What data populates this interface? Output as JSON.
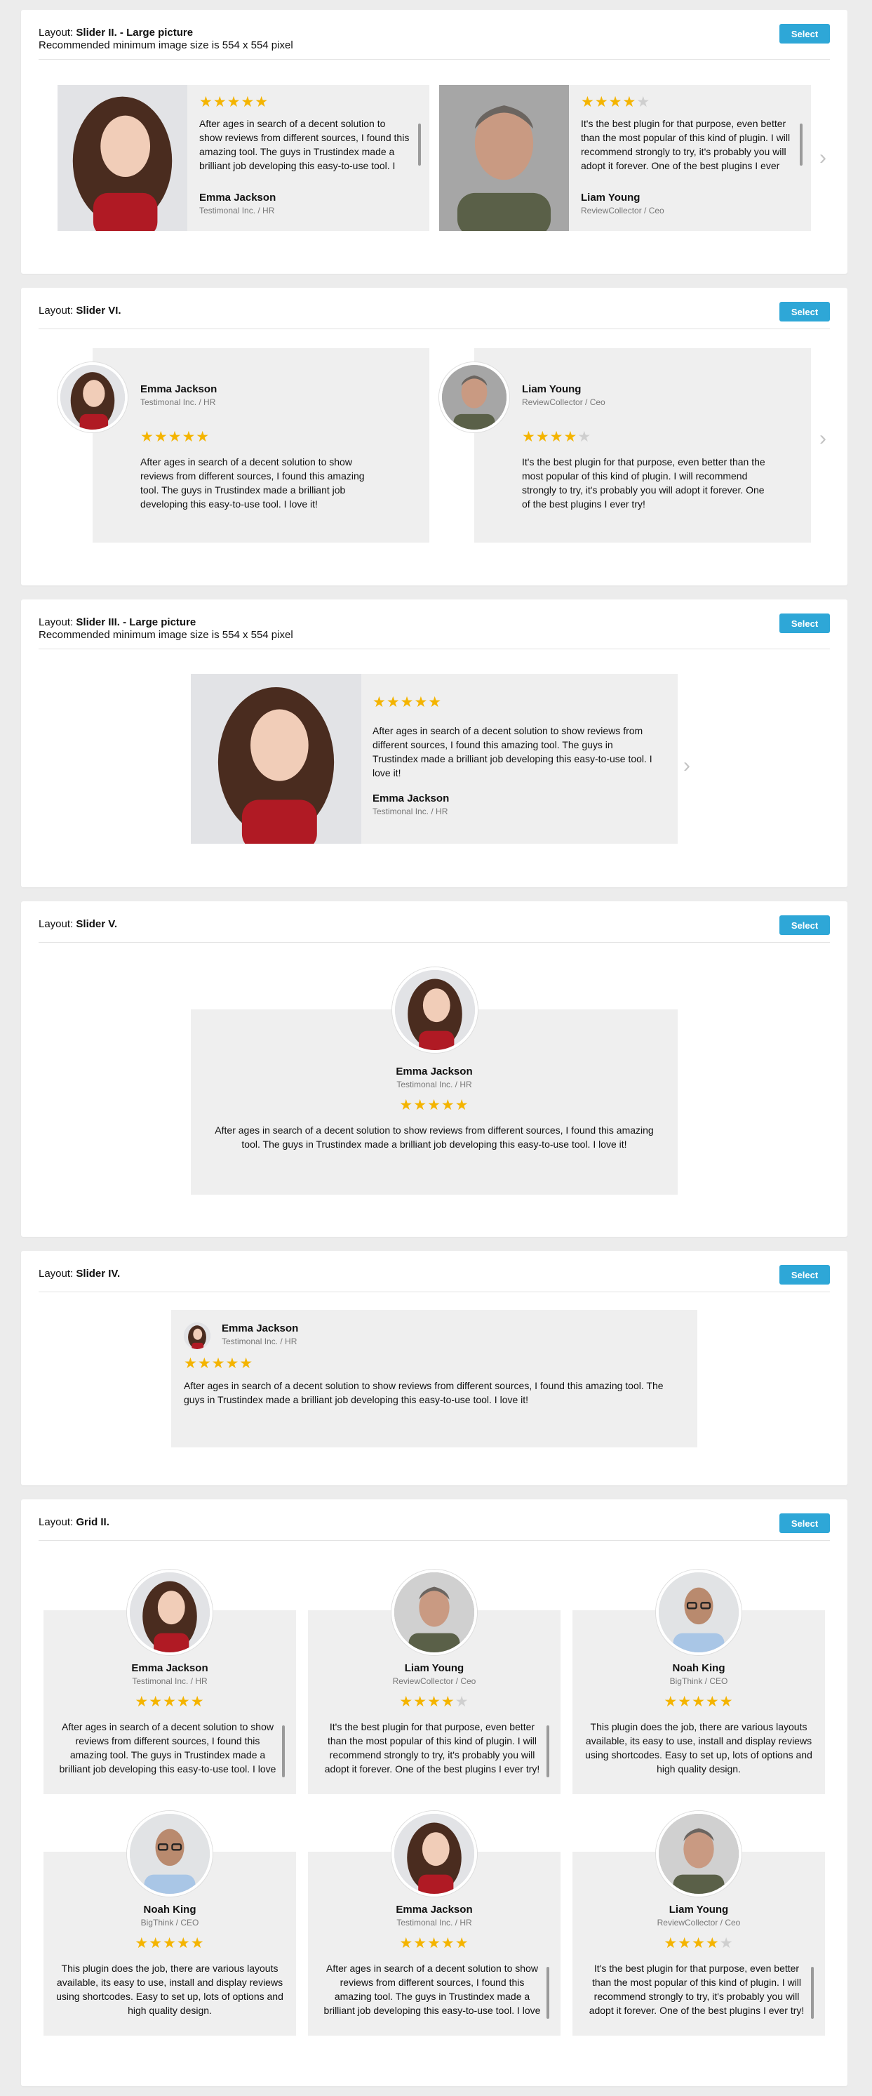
{
  "common": {
    "select_label": "Select",
    "layout_prefix": "Layout:",
    "min_size_note": "Recommended minimum image size is 554 x 554 pixel"
  },
  "reviews": {
    "emma": {
      "name": "Emma Jackson",
      "company": "Testimonal Inc. / HR",
      "stars": 5,
      "text": "After ages in search of a decent solution to show reviews from different sources, I found this amazing tool. The guys in Trustindex made a brilliant job developing this easy-to-use tool. I love it!"
    },
    "liam": {
      "name": "Liam Young",
      "company": "ReviewCollector / Ceo",
      "stars": 4,
      "text": "It's the best plugin for that purpose, even better than the most popular of this kind of plugin. I will recommend strongly to try, it's probably you will adopt it forever. One of the best plugins I ever try!"
    },
    "noah": {
      "name": "Noah King",
      "company": "BigThink / CEO",
      "stars": 5,
      "text": "This plugin does the job, there are various layouts available, its easy to use, install and display reviews using shortcodes. Easy to set up, lots of options and high quality design."
    }
  },
  "panels": {
    "slider2": {
      "name": "Slider II. - Large picture"
    },
    "slider6": {
      "name": "Slider VI."
    },
    "slider3": {
      "name": "Slider III. - Large picture"
    },
    "slider5": {
      "name": "Slider V."
    },
    "slider4": {
      "name": "Slider IV."
    },
    "grid2": {
      "name": "Grid II."
    }
  },
  "icons": {
    "star": "star-icon",
    "star_empty": "star-empty-icon",
    "chevron_right": "chevron-right-icon"
  },
  "colors": {
    "accent": "#2ea7d7",
    "star": "#f4b400",
    "card_bg": "#efefef"
  }
}
